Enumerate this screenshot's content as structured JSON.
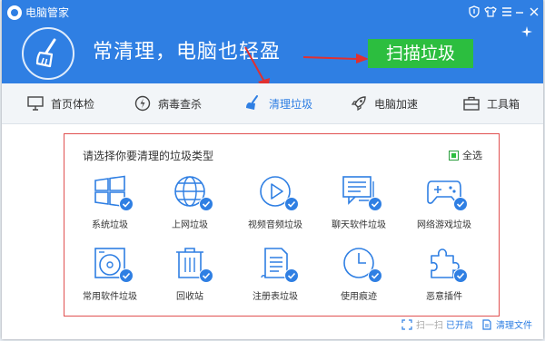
{
  "window": {
    "title": "电脑管家",
    "controls": [
      "shield-icon",
      "shirt-icon",
      "menu-icon",
      "minimize-icon",
      "close-icon"
    ]
  },
  "hero": {
    "slogan": "常清理，电脑也轻盈",
    "scan_button": "扫描垃圾"
  },
  "tabs": [
    {
      "label": "首页体检",
      "icon": "monitor-icon",
      "active": false
    },
    {
      "label": "病毒查杀",
      "icon": "shield-bolt-icon",
      "active": false
    },
    {
      "label": "清理垃圾",
      "icon": "broom-icon",
      "active": true
    },
    {
      "label": "电脑加速",
      "icon": "rocket-icon",
      "active": false
    },
    {
      "label": "工具箱",
      "icon": "toolbox-icon",
      "active": false
    }
  ],
  "panel": {
    "title": "请选择你要清理的垃圾类型",
    "select_all": "全选",
    "select_all_checked": true,
    "items": [
      {
        "label": "系统垃圾",
        "icon": "windows-icon",
        "checked": true
      },
      {
        "label": "上网垃圾",
        "icon": "globe-icon",
        "checked": true
      },
      {
        "label": "视频音频垃圾",
        "icon": "play-icon",
        "checked": true
      },
      {
        "label": "聊天软件垃圾",
        "icon": "chat-icon",
        "checked": true
      },
      {
        "label": "网络游戏垃圾",
        "icon": "gamepad-icon",
        "checked": true
      },
      {
        "label": "常用软件垃圾",
        "icon": "disc-icon",
        "checked": true
      },
      {
        "label": "回收站",
        "icon": "trash-icon",
        "checked": true
      },
      {
        "label": "注册表垃圾",
        "icon": "document-icon",
        "checked": true
      },
      {
        "label": "使用痕迹",
        "icon": "clock-icon",
        "checked": true
      },
      {
        "label": "恶意插件",
        "icon": "puzzle-icon",
        "checked": true
      }
    ]
  },
  "footer": {
    "scan_status": "扫一扫 已开启",
    "scan_status_prefix": "扫一扫",
    "scan_status_suffix": "已开启",
    "clean_files": "清理文件"
  },
  "colors": {
    "primary": "#2f7fe3",
    "accent_green": "#2cbe3f",
    "annotation_red": "#e03030"
  }
}
